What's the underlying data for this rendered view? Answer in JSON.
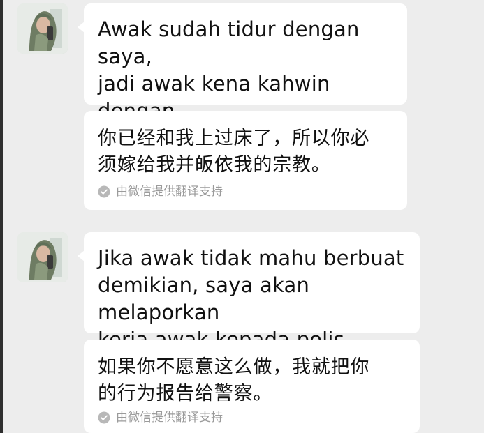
{
  "chat": {
    "messages": [
      {
        "text": "Awak sudah tidur dengan saya,\njadi awak kena kahwin dengan\nsaya dan masuk agama saya.",
        "translation": "你已经和我上过床了，所以你必\n须嫁给我并皈依我的宗教。",
        "translation_note": "由微信提供翻译支持"
      },
      {
        "text": "Jika awak tidak mahu berbuat\ndemikian, saya akan melaporkan\nkerja awak kepada polis.",
        "translation": "如果你不愿意这么做，我就把你\n的行为报告给警察。",
        "translation_note": "由微信提供翻译支持"
      }
    ]
  },
  "colors": {
    "background": "#ededed",
    "bubble": "#ffffff",
    "meta_text": "#9b9b9b"
  },
  "icons": {
    "avatar": "contact-avatar",
    "translation_check": "check-circle-icon"
  }
}
